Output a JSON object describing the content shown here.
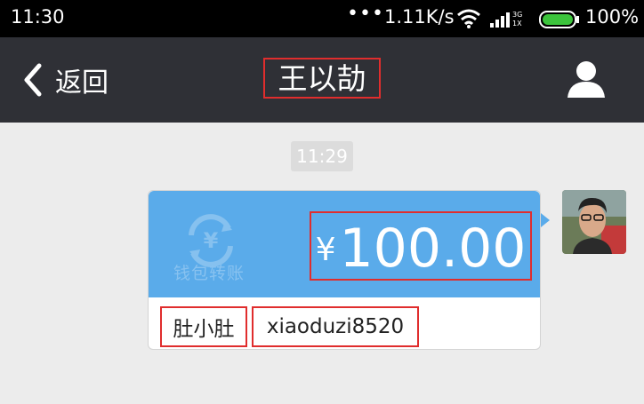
{
  "status_bar": {
    "time": "11:30",
    "dots": "•••",
    "network_speed": "1.11K/s",
    "battery_pct": "100%"
  },
  "nav": {
    "back_label": "返回",
    "title": "王以劼"
  },
  "chat": {
    "timestamp": "11:29"
  },
  "transfer": {
    "wallet_label": "钱包转账",
    "currency_symbol": "¥",
    "amount": "100.00",
    "recipient_name": "肚小肚",
    "recipient_account": "xiaoduzi8520"
  },
  "icons": {
    "back": "chevron-left-icon",
    "contact": "person-icon",
    "wallet": "wallet-transfer-icon",
    "wifi": "wifi-icon",
    "signal": "signal-icon",
    "battery": "battery-icon"
  },
  "colors": {
    "nav_bar": "#2f3036",
    "status_bar": "#000000",
    "card_top": "#5aabea",
    "highlight_border": "#e02d2d",
    "battery_fill": "#3cc43c",
    "background": "#ececec"
  },
  "battery_level": 1.0
}
